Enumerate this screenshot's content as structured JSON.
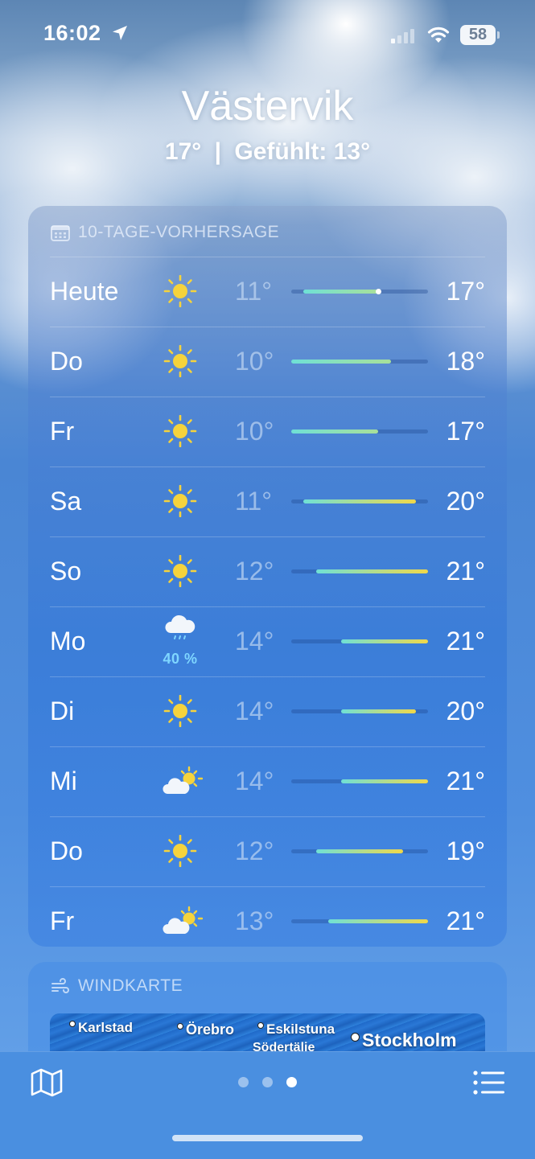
{
  "status_bar": {
    "time": "16:02",
    "battery": "58"
  },
  "location": {
    "city": "Västervik",
    "current_temp": "17°",
    "separator": "|",
    "feels_like": "Gefühlt: 13°"
  },
  "forecast": {
    "title": "10-TAGE-VORHERSAGE",
    "range_min": 10,
    "range_max": 21,
    "current_temp_value": 17,
    "days": [
      {
        "day": "Heute",
        "icon": "sun-icon",
        "low": "11°",
        "high": "17°",
        "low_value": 11,
        "high_value": 17,
        "precip": ""
      },
      {
        "day": "Do",
        "icon": "sun-icon",
        "low": "10°",
        "high": "18°",
        "low_value": 10,
        "high_value": 18,
        "precip": ""
      },
      {
        "day": "Fr",
        "icon": "sun-icon",
        "low": "10°",
        "high": "17°",
        "low_value": 10,
        "high_value": 17,
        "precip": ""
      },
      {
        "day": "Sa",
        "icon": "sun-icon",
        "low": "11°",
        "high": "20°",
        "low_value": 11,
        "high_value": 20,
        "precip": ""
      },
      {
        "day": "So",
        "icon": "sun-icon",
        "low": "12°",
        "high": "21°",
        "low_value": 12,
        "high_value": 21,
        "precip": ""
      },
      {
        "day": "Mo",
        "icon": "cloud-rain-icon",
        "low": "14°",
        "high": "21°",
        "low_value": 14,
        "high_value": 21,
        "precip": "40 %"
      },
      {
        "day": "Di",
        "icon": "sun-icon",
        "low": "14°",
        "high": "20°",
        "low_value": 14,
        "high_value": 20,
        "precip": ""
      },
      {
        "day": "Mi",
        "icon": "partly-cloudy-icon",
        "low": "14°",
        "high": "21°",
        "low_value": 14,
        "high_value": 21,
        "precip": ""
      },
      {
        "day": "Do",
        "icon": "sun-icon",
        "low": "12°",
        "high": "19°",
        "low_value": 12,
        "high_value": 19,
        "precip": ""
      },
      {
        "day": "Fr",
        "icon": "partly-cloudy-icon",
        "low": "13°",
        "high": "21°",
        "low_value": 13,
        "high_value": 21,
        "precip": ""
      }
    ]
  },
  "wind_map": {
    "title": "WINDKARTE",
    "places": [
      "Karlstad",
      "Örebro",
      "Eskilstuna",
      "Stockholm",
      "Södertälje"
    ]
  },
  "toolbar": {
    "map_icon": "map-icon",
    "list_icon": "list-icon",
    "pages": 3,
    "active_page": 2
  },
  "colors": {
    "cool": "#6fe0d6",
    "mid": "#a8e09a",
    "warm": "#f0d84a",
    "precip": "#7fd6ff"
  }
}
